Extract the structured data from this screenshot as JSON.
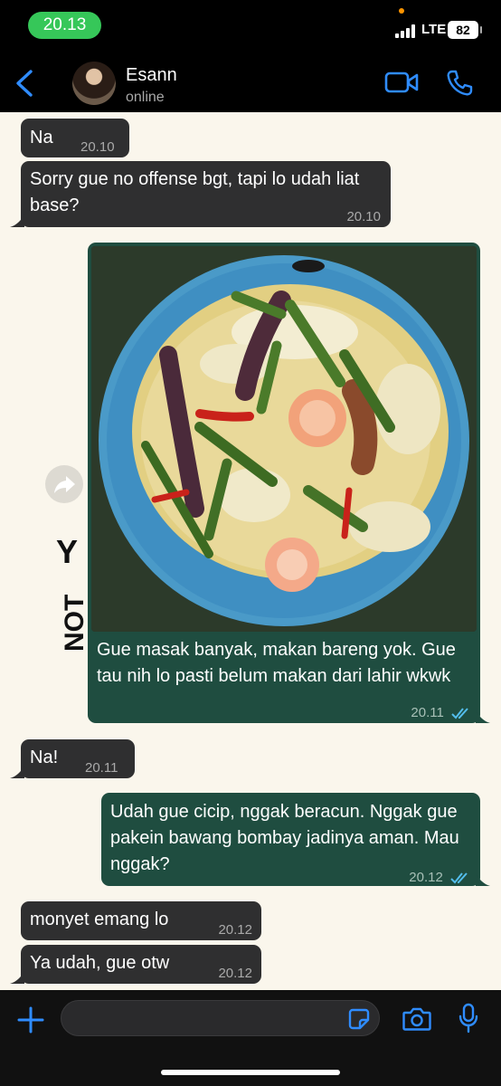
{
  "status_bar": {
    "time": "20.13",
    "network": "LTE",
    "battery": "82"
  },
  "header": {
    "contact_name": "Esann",
    "presence": "online"
  },
  "messages": [
    {
      "text": "Na",
      "time": "20.10"
    },
    {
      "text": "Sorry gue no offense bgt, tapi lo udah liat base?",
      "time": "20.10"
    },
    {
      "text": "Gue masak banyak, makan bareng yok. Gue tau nih lo pasti belum makan dari lahir wkwk",
      "time": "20.11"
    },
    {
      "text": "Na!",
      "time": "20.11"
    },
    {
      "text": "Udah gue cicip, nggak beracun. Nggak gue pakein bawang bombay jadinya aman. Mau nggak?",
      "time": "20.12"
    },
    {
      "text": "monyet emang lo",
      "time": "20.12"
    },
    {
      "text": "Ya udah, gue otw",
      "time": "20.12"
    }
  ],
  "watermark": "NOT Y",
  "icons": {
    "back": "chevron-left-icon",
    "video": "video-camera-icon",
    "call": "phone-icon",
    "forward": "share-arrow-icon",
    "read": "double-check-icon",
    "attach": "plus-icon",
    "sticker": "sticker-icon",
    "camera": "camera-icon",
    "mic": "microphone-icon"
  },
  "colors": {
    "accent": "#2f8cff",
    "status_pill": "#36c759",
    "incoming_bubble": "#2f2f30",
    "outgoing_bubble": "#1f4d40",
    "chat_bg": "#faf6ec",
    "read_check": "#53bdeb"
  }
}
